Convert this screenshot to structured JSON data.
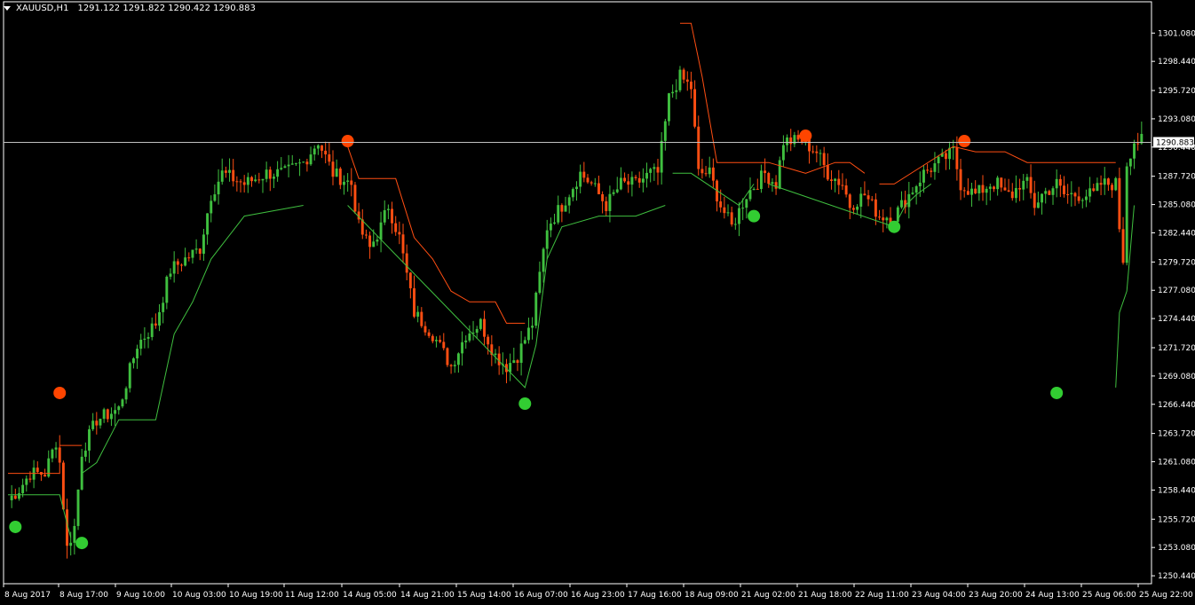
{
  "header": {
    "symbol": "XAUUSD,H1",
    "ohlc": "1291.122 1291.822 1290.422 1290.883"
  },
  "colors": {
    "background": "#000000",
    "bull": "#3fbf3f",
    "bear": "#ff4e12",
    "axis": "#ffffff",
    "price_line": "#c0c0c0",
    "dot_buy": "#32cd32",
    "dot_sell": "#ff4500"
  },
  "chart_data": {
    "type": "candlestick",
    "current_price": "1290.883",
    "ylim": [
      1249.7,
      1304.0
    ],
    "y_ticks": [
      "1301.080",
      "1298.440",
      "1295.720",
      "1293.080",
      "1290.440",
      "1287.720",
      "1285.080",
      "1282.440",
      "1279.720",
      "1277.080",
      "1274.440",
      "1271.720",
      "1269.080",
      "1266.440",
      "1263.720",
      "1261.080",
      "1258.440",
      "1255.720",
      "1253.080",
      "1250.440"
    ],
    "x_ticks": [
      "8 Aug 2017",
      "8 Aug 17:00",
      "9 Aug 10:00",
      "10 Aug 03:00",
      "10 Aug 19:00",
      "11 Aug 12:00",
      "14 Aug 05:00",
      "14 Aug 21:00",
      "15 Aug 14:00",
      "16 Aug 07:00",
      "16 Aug 23:00",
      "17 Aug 16:00",
      "18 Aug 09:00",
      "21 Aug 02:00",
      "21 Aug 18:00",
      "22 Aug 11:00",
      "23 Aug 04:00",
      "23 Aug 20:00",
      "24 Aug 13:00",
      "25 Aug 06:00",
      "25 Aug 22:00"
    ],
    "bar_count": 270,
    "close_path": [
      [
        0,
        1257.5
      ],
      [
        3,
        1258.5
      ],
      [
        6,
        1260
      ],
      [
        10,
        1260
      ],
      [
        13,
        1263
      ],
      [
        14,
        1261
      ],
      [
        16,
        1253
      ],
      [
        18,
        1255
      ],
      [
        20,
        1262
      ],
      [
        24,
        1265
      ],
      [
        30,
        1266
      ],
      [
        35,
        1272
      ],
      [
        40,
        1274
      ],
      [
        44,
        1279
      ],
      [
        48,
        1280
      ],
      [
        52,
        1281
      ],
      [
        55,
        1286
      ],
      [
        58,
        1288
      ],
      [
        64,
        1287
      ],
      [
        70,
        1288
      ],
      [
        75,
        1288
      ],
      [
        80,
        1289
      ],
      [
        84,
        1291
      ],
      [
        88,
        1288
      ],
      [
        93,
        1287
      ],
      [
        95,
        1283
      ],
      [
        98,
        1281
      ],
      [
        101,
        1283
      ],
      [
        103,
        1285
      ],
      [
        106,
        1282
      ],
      [
        110,
        1275
      ],
      [
        115,
        1273
      ],
      [
        120,
        1270
      ],
      [
        124,
        1273
      ],
      [
        128,
        1274
      ],
      [
        132,
        1271
      ],
      [
        135,
        1270
      ],
      [
        138,
        1271
      ],
      [
        142,
        1274
      ],
      [
        146,
        1283
      ],
      [
        150,
        1285
      ],
      [
        155,
        1288
      ],
      [
        158,
        1287
      ],
      [
        162,
        1285
      ],
      [
        166,
        1287
      ],
      [
        170,
        1287
      ],
      [
        174,
        1288
      ],
      [
        176,
        1288
      ],
      [
        179,
        1295
      ],
      [
        182,
        1297
      ],
      [
        185,
        1296
      ],
      [
        187,
        1288
      ],
      [
        190,
        1288
      ],
      [
        193,
        1285
      ],
      [
        196,
        1283
      ],
      [
        200,
        1286
      ],
      [
        205,
        1288
      ],
      [
        208,
        1287
      ],
      [
        210,
        1291
      ],
      [
        215,
        1291
      ],
      [
        219,
        1290
      ],
      [
        222,
        1288
      ],
      [
        226,
        1287
      ],
      [
        228,
        1285
      ],
      [
        232,
        1286
      ],
      [
        236,
        1284
      ],
      [
        240,
        1284
      ],
      [
        244,
        1286
      ],
      [
        248,
        1288
      ],
      [
        252,
        1289
      ],
      [
        256,
        1290
      ],
      [
        258,
        1287
      ],
      [
        262,
        1286
      ],
      [
        266,
        1287
      ],
      [
        268,
        1287
      ],
      [
        270,
        1286
      ],
      [
        272,
        1286
      ],
      [
        274,
        1287
      ],
      [
        276,
        1287
      ],
      [
        278,
        1285
      ],
      [
        280,
        1286
      ],
      [
        284,
        1287
      ],
      [
        286,
        1286
      ],
      [
        290,
        1286
      ],
      [
        294,
        1286
      ],
      [
        296,
        1287
      ],
      [
        298,
        1287
      ],
      [
        300,
        1287
      ],
      [
        301,
        1283
      ],
      [
        302,
        1280
      ],
      [
        303,
        1289
      ],
      [
        305,
        1291
      ],
      [
        307,
        1291
      ]
    ],
    "trail_up": [
      [
        0,
        1258
      ],
      [
        14,
        1258
      ],
      [
        17,
        1254
      ],
      [
        20,
        1260
      ],
      [
        24,
        1261
      ],
      [
        30,
        1265
      ],
      [
        40,
        1265
      ],
      [
        45,
        1273
      ],
      [
        50,
        1276
      ],
      [
        55,
        1280
      ],
      [
        64,
        1284
      ],
      [
        80,
        1285
      ],
      [
        92,
        1285
      ],
      [
        140,
        1268
      ],
      [
        143,
        1272
      ],
      [
        146,
        1280
      ],
      [
        150,
        1283
      ],
      [
        160,
        1284
      ],
      [
        170,
        1284
      ],
      [
        178,
        1285
      ],
      [
        180,
        1288
      ],
      [
        185,
        1288
      ],
      [
        198,
        1285
      ],
      [
        202,
        1287
      ],
      [
        206,
        1287
      ],
      [
        240,
        1283
      ],
      [
        243,
        1285
      ],
      [
        246,
        1286
      ],
      [
        250,
        1287
      ],
      [
        300,
        1268
      ],
      [
        301,
        1275
      ],
      [
        303,
        1277
      ],
      [
        305,
        1285
      ]
    ],
    "trail_down": [
      [
        92,
        1290.5
      ],
      [
        95,
        1287.5
      ],
      [
        100,
        1287.5
      ],
      [
        105,
        1287.5
      ],
      [
        110,
        1282
      ],
      [
        115,
        1280
      ],
      [
        120,
        1277
      ],
      [
        125,
        1276
      ],
      [
        132,
        1276
      ],
      [
        135,
        1274
      ],
      [
        140,
        1274
      ],
      [
        182,
        1302
      ],
      [
        185,
        1302
      ],
      [
        188,
        1297
      ],
      [
        192,
        1289
      ],
      [
        198,
        1289
      ],
      [
        206,
        1289
      ],
      [
        216,
        1288
      ],
      [
        224,
        1289
      ],
      [
        228,
        1289
      ],
      [
        232,
        1288
      ],
      [
        236,
        1287
      ],
      [
        240,
        1287
      ],
      [
        256,
        1290.5
      ],
      [
        262,
        1290
      ],
      [
        270,
        1290
      ],
      [
        276,
        1289
      ],
      [
        280,
        1289
      ],
      [
        290,
        1289
      ],
      [
        300,
        1289
      ]
    ],
    "signals": [
      {
        "bar": 2,
        "price": 1255,
        "type": "buy"
      },
      {
        "bar": 14,
        "price": 1267.5,
        "type": "sell"
      },
      {
        "bar": 20,
        "price": 1253.5,
        "type": "buy"
      },
      {
        "bar": 92,
        "price": 1291,
        "type": "sell"
      },
      {
        "bar": 140,
        "price": 1266.5,
        "type": "buy"
      },
      {
        "bar": 202,
        "price": 1284,
        "type": "buy"
      },
      {
        "bar": 216,
        "price": 1291.5,
        "type": "sell"
      },
      {
        "bar": 240,
        "price": 1283,
        "type": "buy"
      },
      {
        "bar": 259,
        "price": 1291,
        "type": "sell"
      },
      {
        "bar": 284,
        "price": 1267.5,
        "type": "buy"
      }
    ]
  }
}
